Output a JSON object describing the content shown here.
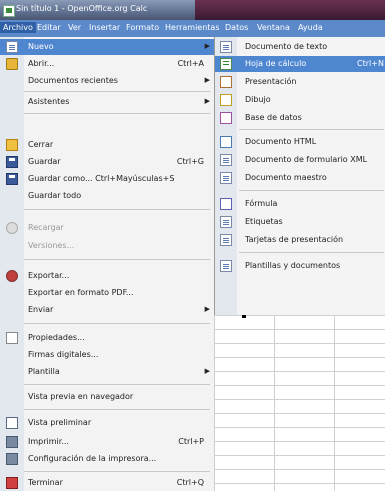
{
  "window": {
    "title": "Sin título 1 - OpenOffice.org Calc"
  },
  "menubar": [
    {
      "label": "Archivo",
      "active": true
    },
    {
      "label": "Editar"
    },
    {
      "label": "Ver"
    },
    {
      "label": "Insertar"
    },
    {
      "label": "Formato"
    },
    {
      "label": "Herramientas"
    },
    {
      "label": "Datos"
    },
    {
      "label": "Ventana"
    },
    {
      "label": "Ayuda"
    }
  ],
  "file_menu": {
    "items": [
      {
        "label": "Nuevo",
        "icon": "new-document-icon",
        "submenu": true,
        "highlighted": true
      },
      {
        "label": "Abrir...",
        "icon": "open-folder-icon",
        "shortcut": "Ctrl+A"
      },
      {
        "label": "Documentos recientes",
        "submenu": true
      },
      {
        "label": "Asistentes",
        "submenu": true
      },
      {
        "label": "Cerrar",
        "icon": "close-icon"
      },
      {
        "label": "Guardar",
        "icon": "save-icon",
        "shortcut": "Ctrl+G"
      },
      {
        "label": "Guardar como...  Ctrl+Mayúsculas+S",
        "icon": "save-as-icon"
      },
      {
        "label": "Guardar todo"
      },
      {
        "label": "Recargar",
        "icon": "reload-icon",
        "disabled": true
      },
      {
        "label": "Versiones...",
        "disabled": true
      },
      {
        "label": "Exportar...",
        "icon": "export-icon"
      },
      {
        "label": "Exportar en formato PDF..."
      },
      {
        "label": "Enviar",
        "submenu": true
      },
      {
        "label": "Propiedades...",
        "icon": "properties-icon"
      },
      {
        "label": "Firmas digitales..."
      },
      {
        "label": "Plantilla",
        "submenu": true
      },
      {
        "label": "Vista previa en navegador"
      },
      {
        "label": "Vista preliminar",
        "icon": "print-preview-icon"
      },
      {
        "label": "Imprimir...",
        "icon": "print-icon",
        "shortcut": "Ctrl+P"
      },
      {
        "label": "Configuración de la impresora...",
        "icon": "printer-settings-icon"
      },
      {
        "label": "Terminar",
        "icon": "exit-icon",
        "shortcut": "Ctrl+Q"
      }
    ]
  },
  "new_submenu": {
    "items": [
      {
        "label": "Documento de texto",
        "icon": "text-document-icon"
      },
      {
        "label": "Hoja de cálculo",
        "icon": "spreadsheet-icon",
        "shortcut": "Ctrl+N",
        "highlighted": true
      },
      {
        "label": "Presentación",
        "icon": "presentation-icon"
      },
      {
        "label": "Dibujo",
        "icon": "drawing-icon"
      },
      {
        "label": "Base de datos",
        "icon": "database-icon"
      },
      {
        "label": "Documento HTML",
        "icon": "html-document-icon"
      },
      {
        "label": "Documento de formulario XML",
        "icon": "xml-form-icon"
      },
      {
        "label": "Documento maestro",
        "icon": "master-document-icon"
      },
      {
        "label": "Fórmula",
        "icon": "formula-icon"
      },
      {
        "label": "Etiquetas",
        "icon": "labels-icon"
      },
      {
        "label": "Tarjetas de presentación",
        "icon": "business-cards-icon"
      },
      {
        "label": "Plantillas y documentos",
        "icon": "templates-icon"
      }
    ]
  }
}
